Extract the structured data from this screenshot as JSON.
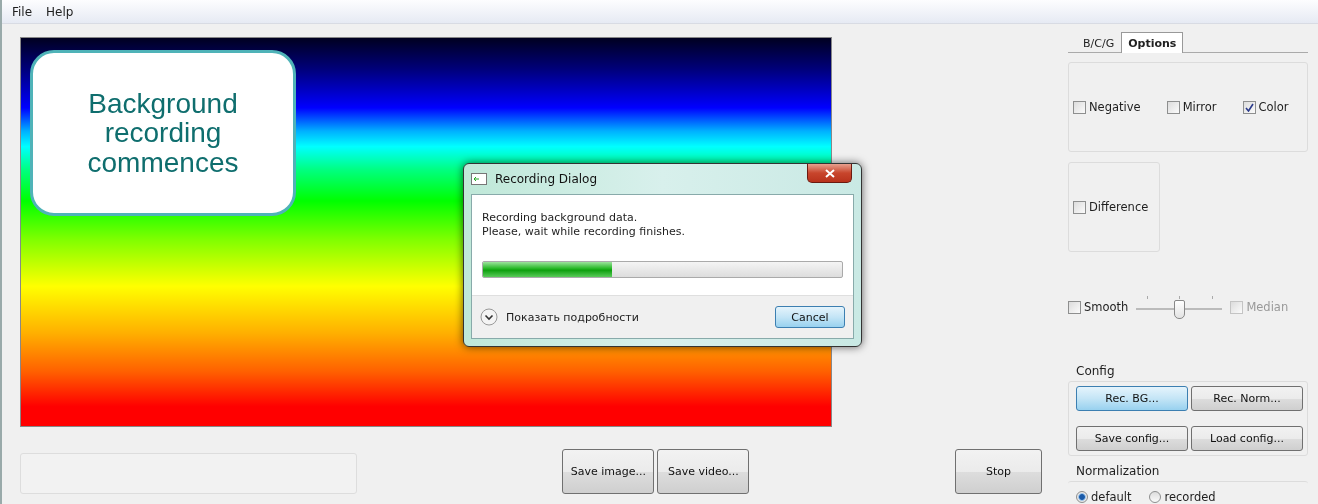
{
  "menu": [
    {
      "label": "File"
    },
    {
      "label": "Help"
    }
  ],
  "callout": {
    "text": "Background recording commences"
  },
  "dialog": {
    "title": "Recording Dialog",
    "message_lines": [
      "Recording background data.",
      "Please, wait while recording finishes."
    ],
    "progress": {
      "level": 0.36
    },
    "details_toggle": {
      "label": "Показать подробности",
      "expanded": false
    },
    "cancel_button": {
      "label": "Cancel"
    }
  },
  "bottom_buttons": [
    {
      "label": "Save image..."
    },
    {
      "label": "Save video..."
    }
  ],
  "stop_button": {
    "label": "Stop"
  },
  "tabs": [
    {
      "label": "B/C/G",
      "selected": false
    },
    {
      "label": "Options",
      "selected": true
    }
  ],
  "options": [
    {
      "label": "Negative",
      "checked": false
    },
    {
      "label": "Mirror",
      "checked": false
    },
    {
      "label": "Color",
      "checked": true
    }
  ],
  "difference": {
    "label": "Difference",
    "checked": false
  },
  "smooth": {
    "label": "Smooth",
    "checked": false
  },
  "smooth_slider": {
    "level": 0.5
  },
  "median": {
    "label": "Median",
    "checked": false,
    "disabled": true
  },
  "config": {
    "title": "Config",
    "buttons": [
      {
        "label": "Rec. BG...",
        "focused": true
      },
      {
        "label": "Rec. Norm...",
        "focused": false
      },
      {
        "label": "Save config...",
        "focused": false
      },
      {
        "label": "Load config...",
        "focused": false
      }
    ]
  },
  "normalization": {
    "title": "Normalization",
    "options": [
      {
        "label": "default",
        "selected": true
      },
      {
        "label": "recorded",
        "selected": false
      }
    ]
  }
}
